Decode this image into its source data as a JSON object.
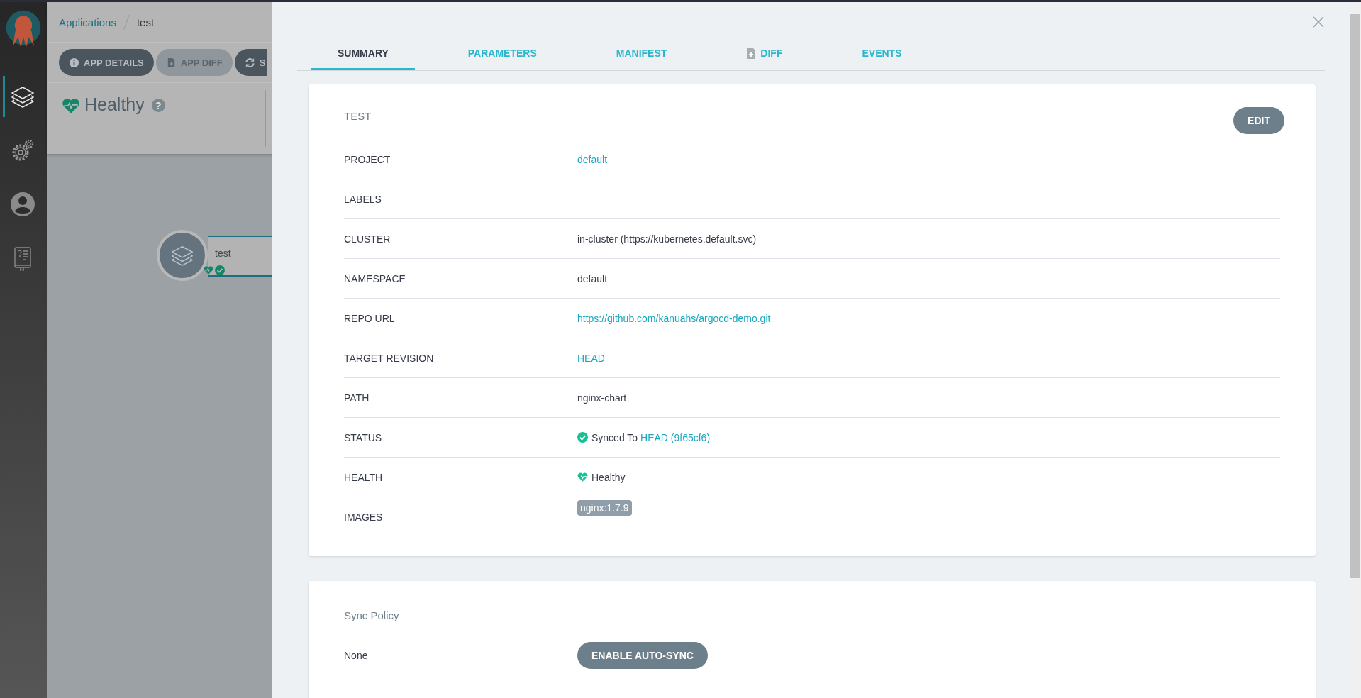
{
  "sidebar": {
    "items": [
      {
        "kind": "layers",
        "selected": true
      },
      {
        "kind": "gears",
        "selected": false
      },
      {
        "kind": "user",
        "selected": false
      },
      {
        "kind": "docs",
        "selected": false
      }
    ]
  },
  "breadcrumb": [
    {
      "label": "Applications",
      "kind": "link"
    },
    {
      "label": "test",
      "kind": "current"
    }
  ],
  "toolbar": [
    {
      "label": "APP DETAILS",
      "kind": "info",
      "disabled": false
    },
    {
      "label": "APP DIFF",
      "kind": "file",
      "disabled": true
    },
    {
      "label": "S",
      "kind": "sync",
      "disabled": false
    }
  ],
  "health": {
    "label": "Healthy",
    "help": "?"
  },
  "node": {
    "name": "test"
  },
  "panel": {
    "tabs": [
      {
        "label": "SUMMARY",
        "selected": true,
        "kind": "plain"
      },
      {
        "label": "PARAMETERS",
        "selected": false,
        "kind": "plain"
      },
      {
        "label": "MANIFEST",
        "selected": false,
        "kind": "plain"
      },
      {
        "label": "DIFF",
        "selected": false,
        "kind": "file"
      },
      {
        "label": "EVENTS",
        "selected": false,
        "kind": "plain"
      }
    ],
    "summary": {
      "title": "TEST",
      "edit": "EDIT",
      "rows": [
        {
          "label": "PROJECT",
          "kind": "link",
          "value": "default"
        },
        {
          "label": "LABELS",
          "kind": "empty"
        },
        {
          "label": "CLUSTER",
          "kind": "text",
          "value": "in-cluster (https://kubernetes.default.svc)"
        },
        {
          "label": "NAMESPACE",
          "kind": "text",
          "value": "default"
        },
        {
          "label": "REPO URL",
          "kind": "link",
          "value": "https://github.com/kanuahs/argocd-demo.git"
        },
        {
          "label": "TARGET REVISION",
          "kind": "link",
          "value": "HEAD"
        },
        {
          "label": "PATH",
          "kind": "text",
          "value": "nginx-chart"
        },
        {
          "label": "STATUS",
          "kind": "status",
          "value": "Synced To",
          "link": "HEAD (9f65cf6)"
        },
        {
          "label": "HEALTH",
          "kind": "health",
          "value": "Healthy"
        },
        {
          "label": "IMAGES",
          "kind": "tags",
          "tags": [
            "nginx:1.7.9"
          ]
        }
      ]
    },
    "sync_policy": {
      "title": "Sync Policy",
      "value": "None",
      "button": "ENABLE AUTO-SYNC"
    }
  }
}
